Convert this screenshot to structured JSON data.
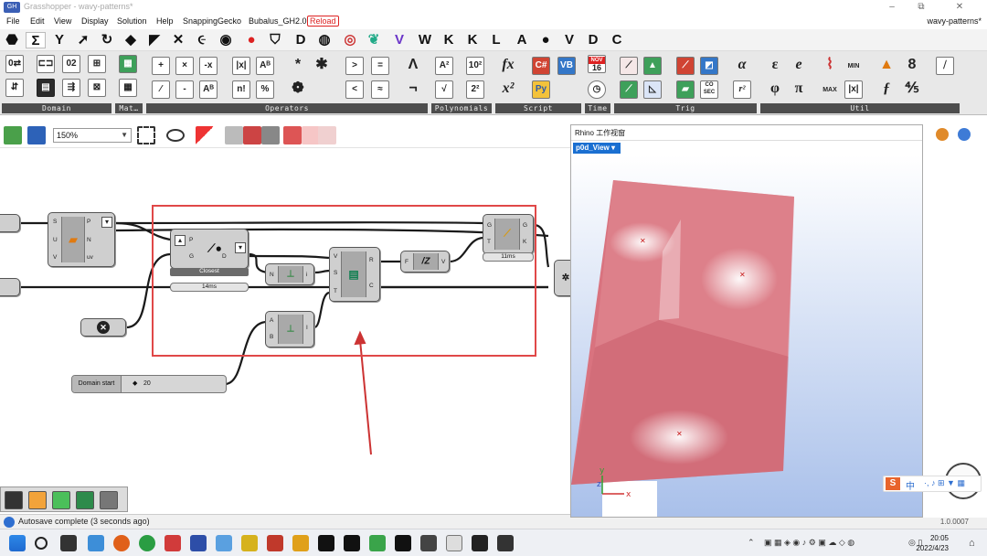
{
  "window": {
    "title": "Grasshopper - wavy-patterns*",
    "doc_name": "wavy-patterns*",
    "minimize": "–",
    "restore": "⧉",
    "close": "✕"
  },
  "menu": {
    "items": [
      "File",
      "Edit",
      "View",
      "Display",
      "Solution",
      "Help",
      "SnappingGecko",
      "Bubalus_GH2.0",
      "Reload"
    ]
  },
  "tabs": {
    "letters": [
      "W",
      "K",
      "K",
      "L",
      "A",
      "V",
      "D",
      "C"
    ],
    "active_symbol": "Σ"
  },
  "ribbon": {
    "groups": [
      "Domain",
      "Mat…",
      "Operators",
      "Polynomials",
      "Script",
      "Time",
      "Trig",
      "Util"
    ],
    "script_icon": "fx",
    "script_icon2": "x²",
    "time_badge": "16",
    "time_month": "NOV",
    "operator_glyphs": [
      "+",
      "×",
      "-x",
      "|x|",
      "*",
      ">",
      "=",
      "Λ",
      "%",
      "-",
      "Aᴮ",
      "n!",
      "%",
      "<",
      "≈",
      "¬"
    ],
    "poly_glyphs": [
      "A²",
      "10²",
      "√",
      "2²"
    ],
    "trig_glyphs": [
      "CO SEC"
    ],
    "util_glyphs": [
      "ε",
      "e",
      "φ",
      "π",
      "MIN",
      "MAX",
      "|x|",
      "8",
      "∞"
    ]
  },
  "canvas_toolbar": {
    "zoom": "150%"
  },
  "canvas": {
    "comp_closest_label": "Closest",
    "comp_closest_time": "14ms",
    "comp_right_time": "11ms",
    "domain_start_label": "Domain start",
    "domain_start_value": "20",
    "ports": {
      "left": {
        "in": [
          "S",
          "U",
          "V"
        ],
        "out": [
          "P",
          "N",
          "uv"
        ]
      },
      "closest": {
        "in": [
          "P",
          "G"
        ],
        "out": [
          "P",
          "D",
          "i"
        ]
      },
      "list": {
        "in": [
          "N"
        ],
        "out": [
          "i"
        ]
      },
      "main": {
        "in": [
          "V",
          "S",
          "T"
        ],
        "out": [
          "R",
          "C"
        ]
      },
      "fz": {
        "in": [
          "F"
        ],
        "out": [
          "V"
        ]
      },
      "gtk": {
        "in": [
          "G",
          "T"
        ],
        "out": [
          "G",
          "K"
        ]
      },
      "ab": {
        "in": [
          "A",
          "B"
        ],
        "out": [
          "I"
        ]
      }
    }
  },
  "status": {
    "text": "Autosave complete (3 seconds ago)",
    "version": "1.0.0007"
  },
  "rhino": {
    "title": "Rhino 工作视窗",
    "viewport_tab": "p0d_View",
    "axes": {
      "x": "x",
      "y": "y",
      "z": "z"
    }
  },
  "taskbar": {
    "time": "20:05",
    "date": "2022/4/23",
    "ime": "中"
  },
  "colors": {
    "surface": "#d9737f",
    "sky": "#a9c0ea",
    "highlight": "#e04848",
    "viewport_tab": "#1a6fd1"
  }
}
